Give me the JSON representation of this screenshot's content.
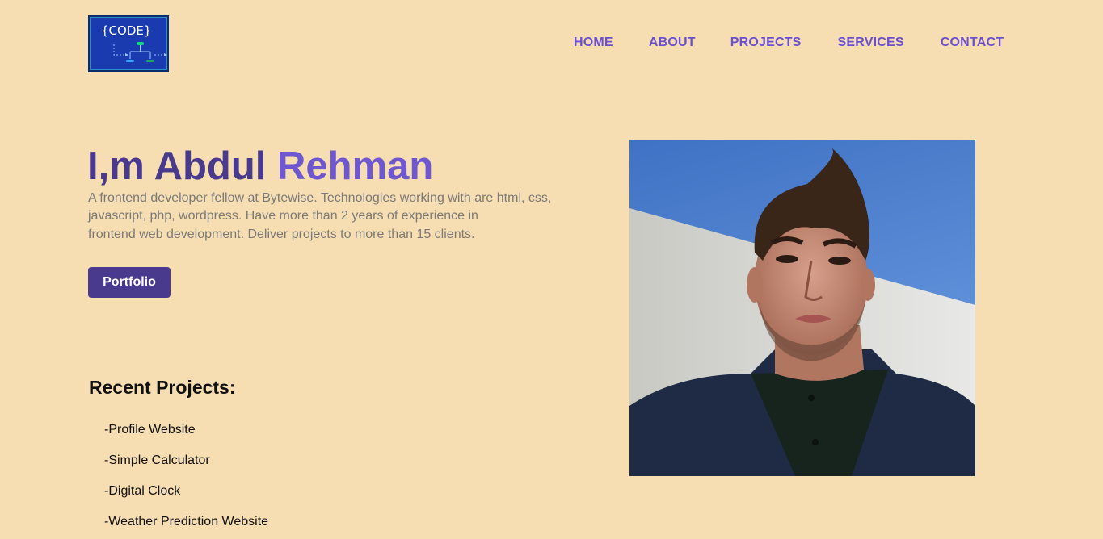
{
  "logo": {
    "text": "{CODE}"
  },
  "nav": [
    {
      "label": "HOME"
    },
    {
      "label": "ABOUT"
    },
    {
      "label": "PROJECTS"
    },
    {
      "label": "SERVICES"
    },
    {
      "label": "CONTACT"
    }
  ],
  "hero": {
    "title_prefix": "I,m Abdul ",
    "title_accent": "Rehman",
    "description_lines": [
      "A frontend developer fellow at Bytewise. Technologies working with are html, css,",
      "javascript, php, wordpress. Have more than 2 years of experience in",
      "frontend web development. Deliver projects to more than 15 clients."
    ],
    "button_label": "Portfolio"
  },
  "recent": {
    "title": "Recent Projects:",
    "items": [
      {
        "label": "-Profile Website"
      },
      {
        "label": "-Simple Calculator"
      },
      {
        "label": "-Digital Clock"
      },
      {
        "label": "-Weather Prediction Website"
      }
    ]
  },
  "colors": {
    "background": "#f6deb2",
    "primary": "#4a3a8e",
    "accent": "#6e57cf",
    "nav": "#6a4fd0"
  }
}
